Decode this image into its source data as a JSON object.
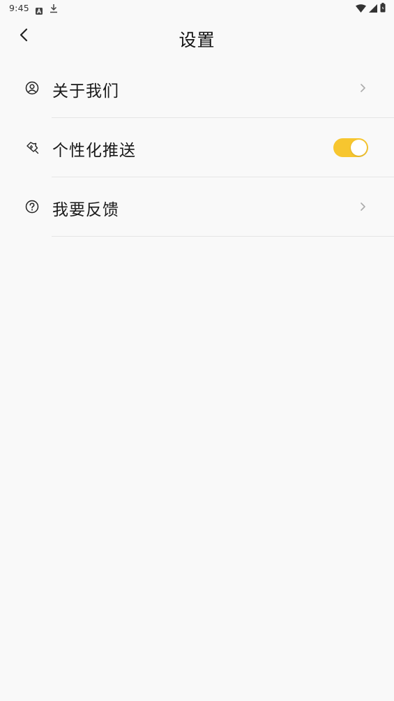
{
  "status_bar": {
    "time": "9:45",
    "icons": [
      "a-icon",
      "download-icon",
      "wifi-icon",
      "signal-icon",
      "battery-icon"
    ]
  },
  "header": {
    "back_icon": "chevron-left-icon",
    "title": "设置"
  },
  "menu": {
    "items": [
      {
        "label": "关于我们",
        "icon": "user-circle-icon",
        "trailing": "chevron-right-icon"
      },
      {
        "label": "个性化推送",
        "icon": "sparkle-badge-icon",
        "trailing": "toggle",
        "toggle_on": true
      },
      {
        "label": "我要反馈",
        "icon": "question-circle-icon",
        "trailing": "chevron-right-icon"
      }
    ]
  },
  "colors": {
    "background": "#f9f9f9",
    "accent": "#f7c62f",
    "divider": "#e6e6e6",
    "chevron": "#aaaaaa"
  }
}
